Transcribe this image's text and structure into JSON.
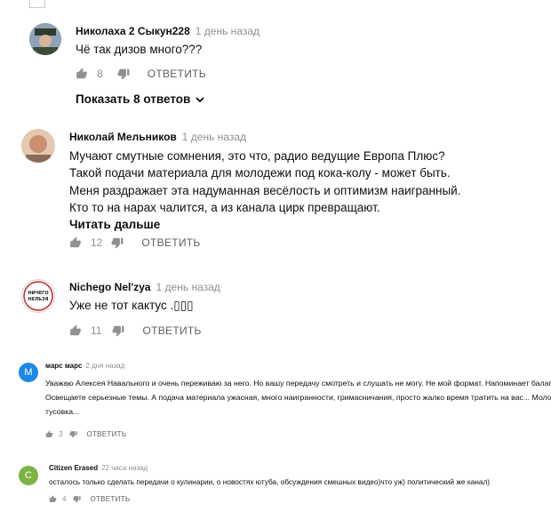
{
  "comments": [
    {
      "author": "Николаха 2 Сыкун228",
      "time": "1 день назад",
      "lines": [
        "Чё так дизов много???"
      ],
      "likes": "8",
      "reply": "ОТВЕТИТЬ",
      "show_replies": "Показать 8 ответов",
      "avatar_color": "#6b7a8c"
    },
    {
      "author": "Николай Мельников",
      "time": "1 день назад",
      "lines": [
        "Мучают смутные сомнения, это что,  радио ведущие Европа Плюс?",
        "Такой подачи материала для молодежи под кока-колу - может быть.",
        "Меня раздражает эта надуманная весёлость и оптимизм наигранный.",
        "Кто то на нарах чалится, а из канала цирк превращают."
      ],
      "read_more": "Читать дальше",
      "likes": "12",
      "reply": "ОТВЕТИТЬ",
      "avatar_color": "#c98f6e"
    },
    {
      "author": "Nichego Nel'zya",
      "time": "1 день назад",
      "lines": [
        "Уже не тот кактус .▯▯▯"
      ],
      "likes": "11",
      "reply": "ОТВЕТИТЬ",
      "avatar_text": "НИЧЕГО\nНЕЛЬЗЯ"
    },
    {
      "author": "марс марс",
      "time": "2 дня назад",
      "lines": [
        "Уважаю Алексея Навального и очень переживаю за него. Но вашу передачу смотреть и слушать не могу. Не мой формат. Напоминает балаган.",
        "Освещаете серьезные темы. А подача материала  ужасная, много наигранности, гримасничания, просто жалко время тратить на вас... Молодёжная",
        "тусовка..."
      ],
      "likes": "3",
      "reply": "ОТВЕТИТЬ",
      "avatar_letter": "М",
      "avatar_color": "#1e88e5"
    },
    {
      "author": "Citizen Erased",
      "time": "22 часа назад",
      "lines": [
        "осталось только сделать передачи  о кулинарии, о новостях ютуба,  обсуждения смешных видео)что уж) политический же канал)"
      ],
      "likes": "4",
      "reply": "ОТВЕТИТЬ",
      "avatar_letter": "C",
      "avatar_color": "#7cb342"
    }
  ]
}
